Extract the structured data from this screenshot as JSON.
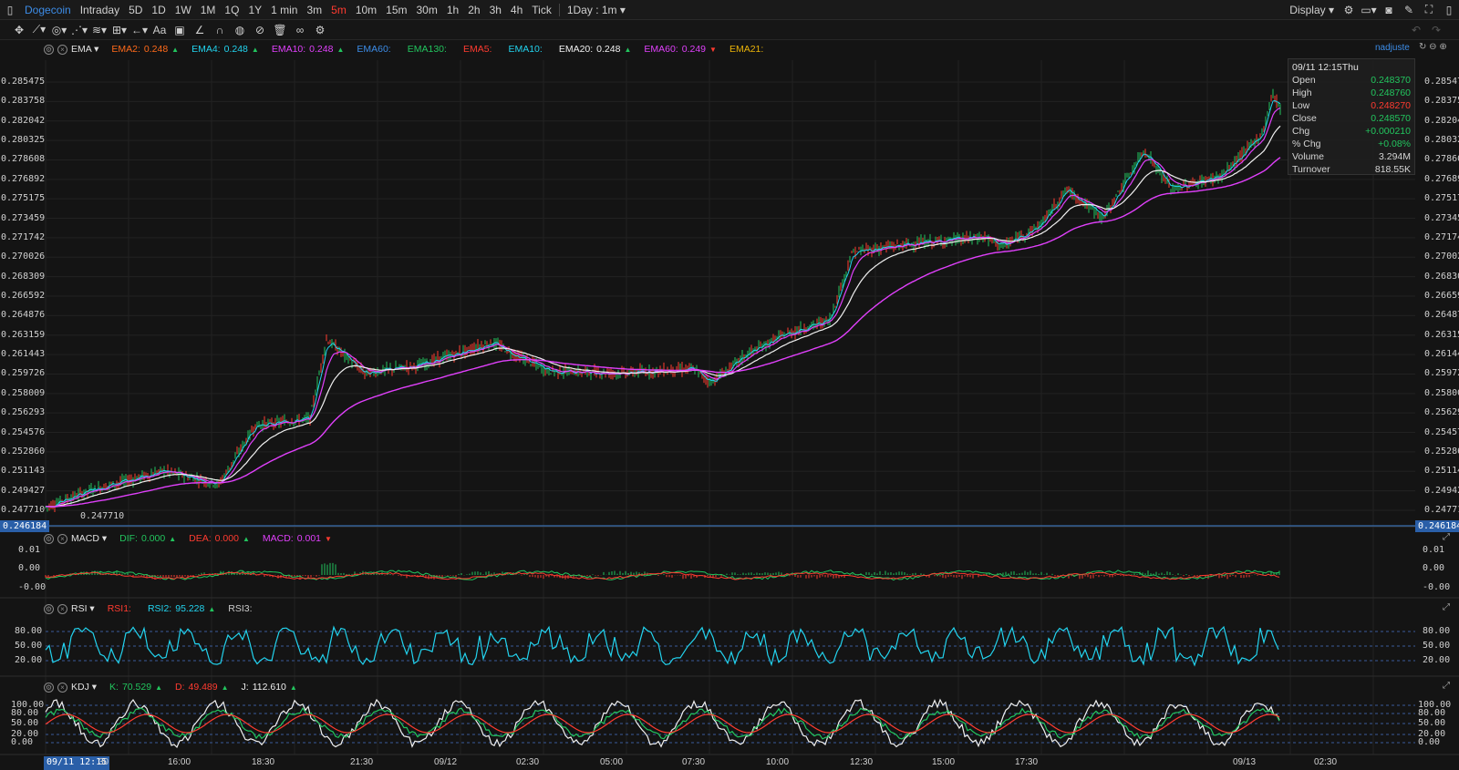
{
  "topbar": {
    "symbol": "Dogecoin",
    "periods": [
      "Intraday",
      "5D",
      "1D",
      "1W",
      "1M",
      "1Q",
      "1Y",
      "1 min",
      "3m",
      "5m",
      "10m",
      "15m",
      "30m",
      "1h",
      "2h",
      "3h",
      "4h",
      "Tick"
    ],
    "active_period": "5m",
    "range": "1Day : 1m",
    "display": "Display"
  },
  "legends": {
    "ema": {
      "name": "EMA",
      "items": [
        {
          "label": "EMA2:",
          "value": "0.248",
          "color": "#ff6a1a",
          "dir": "up"
        },
        {
          "label": "EMA4:",
          "value": "0.248",
          "color": "#22d3ee",
          "dir": "up"
        },
        {
          "label": "EMA10:",
          "value": "0.248",
          "color": "#e040fb",
          "dir": "up"
        },
        {
          "label": "EMA60:",
          "value": "",
          "color": "#3c8ce7",
          "dir": ""
        },
        {
          "label": "EMA130:",
          "value": "",
          "color": "#22c55e",
          "dir": ""
        },
        {
          "label": "EMA5:",
          "value": "",
          "color": "#ff3b30",
          "dir": ""
        },
        {
          "label": "EMA10:",
          "value": "",
          "color": "#22d3ee",
          "dir": ""
        },
        {
          "label": "EMA20:",
          "value": "0.248",
          "color": "#f0f0f0",
          "dir": "up"
        },
        {
          "label": "EMA60:",
          "value": "0.249",
          "color": "#e040fb",
          "dir": "down"
        },
        {
          "label": "EMA21:",
          "value": "",
          "color": "#eab308",
          "dir": ""
        }
      ],
      "right": "nadjuste"
    },
    "macd": {
      "name": "MACD",
      "items": [
        {
          "label": "DIF:",
          "value": "0.000",
          "color": "#22c55e",
          "dir": "up"
        },
        {
          "label": "DEA:",
          "value": "0.000",
          "color": "#ff3b30",
          "dir": "up"
        },
        {
          "label": "MACD:",
          "value": "0.001",
          "color": "#e040fb",
          "dir": "down"
        }
      ]
    },
    "rsi": {
      "name": "RSI",
      "items": [
        {
          "label": "RSI1:",
          "value": "",
          "color": "#ff3b30",
          "dir": ""
        },
        {
          "label": "RSI2:",
          "value": "95.228",
          "color": "#22d3ee",
          "dir": "up"
        },
        {
          "label": "RSI3:",
          "value": "",
          "color": "#cccccc",
          "dir": ""
        }
      ]
    },
    "kdj": {
      "name": "KDJ",
      "items": [
        {
          "label": "K:",
          "value": "70.529",
          "color": "#22c55e",
          "dir": "up"
        },
        {
          "label": "D:",
          "value": "49.489",
          "color": "#ff3b30",
          "dir": "up"
        },
        {
          "label": "J:",
          "value": "112.610",
          "color": "#f0f0f0",
          "dir": "up"
        }
      ]
    }
  },
  "tooltip": {
    "date": "09/11 12:15Thu",
    "rows": [
      {
        "label": "Open",
        "value": "0.248370",
        "color": "#22c55e"
      },
      {
        "label": "High",
        "value": "0.248760",
        "color": "#22c55e"
      },
      {
        "label": "Low",
        "value": "0.248270",
        "color": "#ff3b30"
      },
      {
        "label": "Close",
        "value": "0.248570",
        "color": "#22c55e"
      },
      {
        "label": "Chg",
        "value": "+0.000210",
        "color": "#22c55e"
      },
      {
        "label": "% Chg",
        "value": "+0.08%",
        "color": "#22c55e"
      },
      {
        "label": "Volume",
        "value": "3.294M",
        "color": "#d4d4d4"
      },
      {
        "label": "Turnover",
        "value": "818.55K",
        "color": "#d4d4d4"
      }
    ]
  },
  "price_axis": [
    "0.285475",
    "0.283758",
    "0.282042",
    "0.280325",
    "0.278608",
    "0.276892",
    "0.275175",
    "0.273459",
    "0.271742",
    "0.270026",
    "0.268309",
    "0.266592",
    "0.264876",
    "0.263159",
    "0.261443",
    "0.259726",
    "0.258009",
    "0.256293",
    "0.254576",
    "0.252860",
    "0.251143",
    "0.249427",
    "0.247710"
  ],
  "current_price": "0.246184",
  "low_marker": "0.247710",
  "macd_axis": [
    "0.01",
    "0.00",
    "-0.00"
  ],
  "rsi_axis": [
    "80.00",
    "50.00",
    "20.00"
  ],
  "kdj_axis": [
    "100.00",
    "80.00",
    "50.00",
    "20.00",
    "0.00"
  ],
  "time_axis": [
    "16:00",
    "18:30",
    "21:30",
    "09/12",
    "02:30",
    "05:00",
    "07:30",
    "10:00",
    "12:30",
    "15:00",
    "17:30",
    "09/13",
    "02:30"
  ],
  "time_cursor": "09/11 12:15",
  "time_cursor_tail": "30",
  "colors": {
    "up": "#22c55e",
    "down": "#ff3b30",
    "ema_white": "#f0f0f0",
    "ema_magenta": "#e040fb",
    "rsi": "#22d3ee",
    "bg": "#141414"
  },
  "chart_data": {
    "type": "line",
    "title": "",
    "x": [
      "16:00",
      "18:30",
      "21:30",
      "09/12",
      "02:30",
      "05:00",
      "07:30",
      "10:00",
      "12:30",
      "15:00",
      "17:30",
      "09/13"
    ],
    "series": [
      {
        "name": "",
        "values": [
          0.2512,
          0.2558,
          0.2612,
          0.2618,
          0.2605,
          0.2598,
          0.2603,
          0.264,
          0.2712,
          0.2718,
          0.2745,
          0.282
        ]
      }
    ],
    "ylim": [
      0.246184,
      0.285475
    ]
  }
}
